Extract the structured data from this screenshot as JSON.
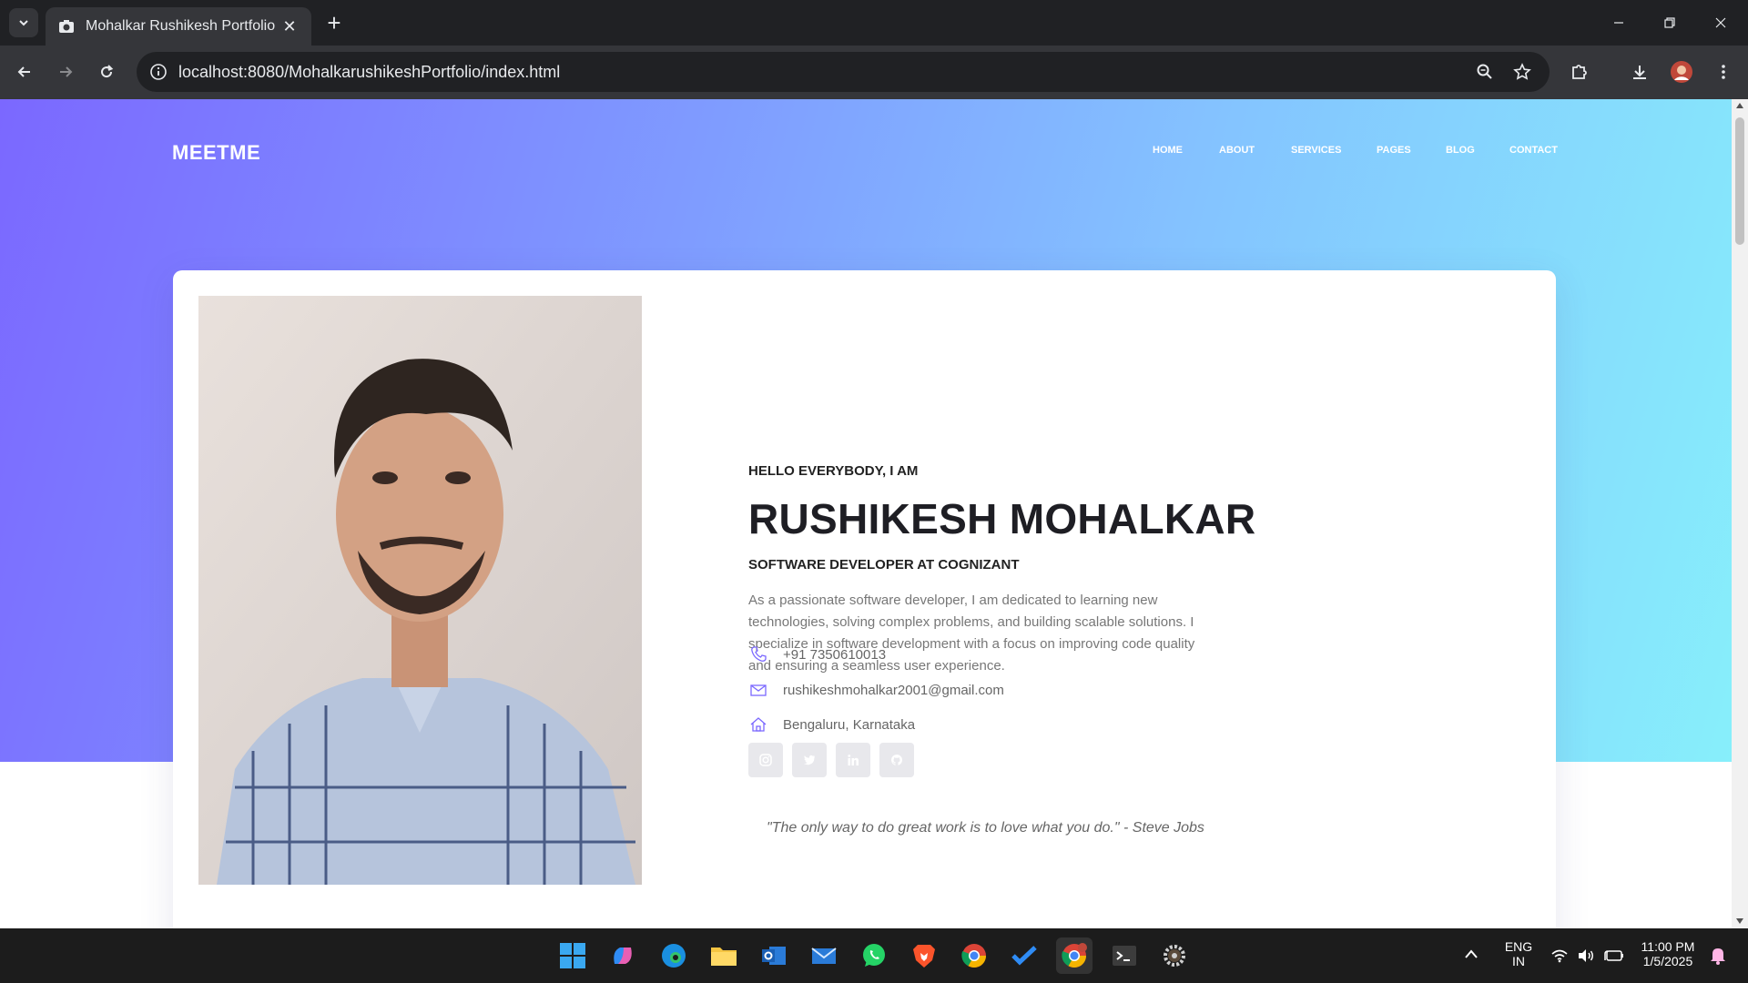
{
  "browser": {
    "tab_title": "Mohalkar Rushikesh Portfolio",
    "url": "localhost:8080/MohalkarushikeshPortfolio/index.html"
  },
  "site": {
    "logo": "MEETME",
    "menu": [
      "HOME",
      "ABOUT",
      "SERVICES",
      "PAGES",
      "BLOG",
      "CONTACT"
    ]
  },
  "profile": {
    "greeting": "HELLO EVERYBODY, I AM",
    "name": "RUSHIKESH MOHALKAR",
    "role": "SOFTWARE DEVELOPER AT COGNIZANT",
    "bio": "As a passionate software developer, I am dedicated to learning new technologies, solving complex problems, and building scalable solutions. I specialize in software development with a focus on improving code quality and ensuring a seamless user experience.",
    "phone": "+91 7350610013",
    "email": "rushikeshmohalkar2001@gmail.com",
    "location": "Bengaluru, Karnataka",
    "social": [
      "instagram-icon",
      "twitter-icon",
      "linkedin-icon",
      "github-icon"
    ],
    "quote": "\"The only way to do great work is to love what you do.\" - Steve Jobs"
  },
  "taskbar": {
    "apps": [
      "start-icon",
      "copilot-icon",
      "edge-icon",
      "file-explorer-icon",
      "outlook-icon",
      "mail-icon",
      "whatsapp-icon",
      "brave-icon",
      "chrome-icon",
      "todo-icon",
      "chrome-profile-icon",
      "terminal-icon",
      "settings-icon"
    ],
    "lang_line1": "ENG",
    "lang_line2": "IN",
    "time": "11:00 PM",
    "date": "1/5/2025"
  },
  "colors": {
    "accent": "#7b68ff",
    "hero_end": "#87effb"
  }
}
